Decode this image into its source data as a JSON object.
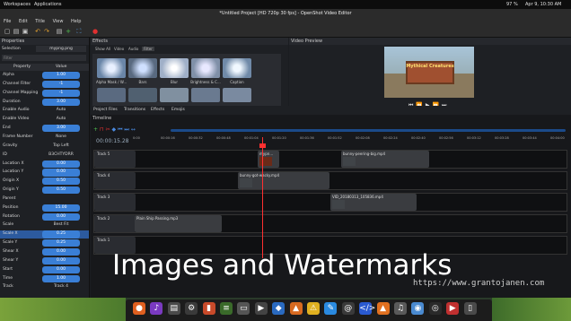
{
  "topbar": {
    "workspaces": "Workspaces",
    "applications": "Applications",
    "battery": "97 %",
    "datetime": "Apr 9, 10:30 AM"
  },
  "window": {
    "title": "*Untitled Project [HD 720p 30 fps] - OpenShot Video Editor"
  },
  "menu": [
    "File",
    "Edit",
    "Title",
    "View",
    "Help"
  ],
  "properties": {
    "title": "Properties",
    "selection_label": "Selection",
    "selection_value": "mypng.png",
    "filter_placeholder": "Filter",
    "col_property": "Property",
    "col_value": "Value",
    "rows": [
      {
        "name": "Alpha",
        "value": "1.00"
      },
      {
        "name": "Channel Filter",
        "value": "-1"
      },
      {
        "name": "Channel Mapping",
        "value": "-1"
      },
      {
        "name": "Duration",
        "value": "3.00"
      },
      {
        "name": "Enable Audio",
        "value": "Auto"
      },
      {
        "name": "Enable Video",
        "value": "Auto"
      },
      {
        "name": "End",
        "value": "3.00"
      },
      {
        "name": "Frame Number",
        "value": "None"
      },
      {
        "name": "Gravity",
        "value": "Top Left"
      },
      {
        "name": "ID",
        "value": "B3CHTYDRR"
      },
      {
        "name": "Location X",
        "value": "0.00"
      },
      {
        "name": "Location Y",
        "value": "0.00"
      },
      {
        "name": "Origin X",
        "value": "0.50"
      },
      {
        "name": "Origin Y",
        "value": "0.50"
      },
      {
        "name": "Parent",
        "value": ""
      },
      {
        "name": "Position",
        "value": "15.00"
      },
      {
        "name": "Rotation",
        "value": "0.00"
      },
      {
        "name": "Scale",
        "value": "Best Fit"
      },
      {
        "name": "Scale X",
        "value": "0.25"
      },
      {
        "name": "Scale Y",
        "value": "0.25"
      },
      {
        "name": "Shear X",
        "value": "0.00"
      },
      {
        "name": "Shear Y",
        "value": "0.00"
      },
      {
        "name": "Start",
        "value": "0.00"
      },
      {
        "name": "Time",
        "value": "1.00"
      },
      {
        "name": "Track",
        "value": "Track 4"
      }
    ]
  },
  "effects": {
    "title": "Effects",
    "tabs": [
      "Show All",
      "Video",
      "Audio",
      "Filter"
    ],
    "items": [
      "Alpha Mask / W...",
      "Bars",
      "Blur",
      "Brightness & C...",
      "Caption"
    ]
  },
  "preview": {
    "title": "Video Preview"
  },
  "project_tabs": [
    "Project Files",
    "Transitions",
    "Effects",
    "Emojis"
  ],
  "timeline": {
    "title": "Timeline",
    "timecode": "00:00:15.28",
    "ruler": [
      "0:00",
      "00:00:16",
      "00:00:32",
      "00:00:48",
      "00:01:04",
      "00:01:20",
      "00:01:36",
      "00:01:52",
      "00:02:08",
      "00:02:24",
      "00:02:40",
      "00:02:56",
      "00:03:12",
      "00:03:28",
      "00:03:44",
      "00:04:00"
    ],
    "tracks": [
      {
        "name": "Track 5",
        "clips": [
          {
            "label": "mypn...",
            "kind": "logo"
          },
          {
            "label": "bunny-peering-big.mp4",
            "kind": "video"
          }
        ]
      },
      {
        "name": "Track 4",
        "clips": [
          {
            "label": "bunny-got-wacky.mp4",
            "kind": "video"
          }
        ]
      },
      {
        "name": "Track 3",
        "clips": [
          {
            "label": "VID_20180313_105836.mp4",
            "kind": "video"
          }
        ]
      },
      {
        "name": "Track 2",
        "clips": [
          {
            "label": "Plain Ship Passing.mp3",
            "kind": "audio"
          }
        ]
      },
      {
        "name": "Track 1",
        "clips": []
      }
    ]
  },
  "overlay": {
    "title": "Images and Watermarks",
    "url": "https://www.grantojanen.com"
  },
  "video_preview_text": "Mythical Creatures",
  "colors": {
    "accent": "#3a7fd6",
    "playhead": "#ff3030"
  }
}
